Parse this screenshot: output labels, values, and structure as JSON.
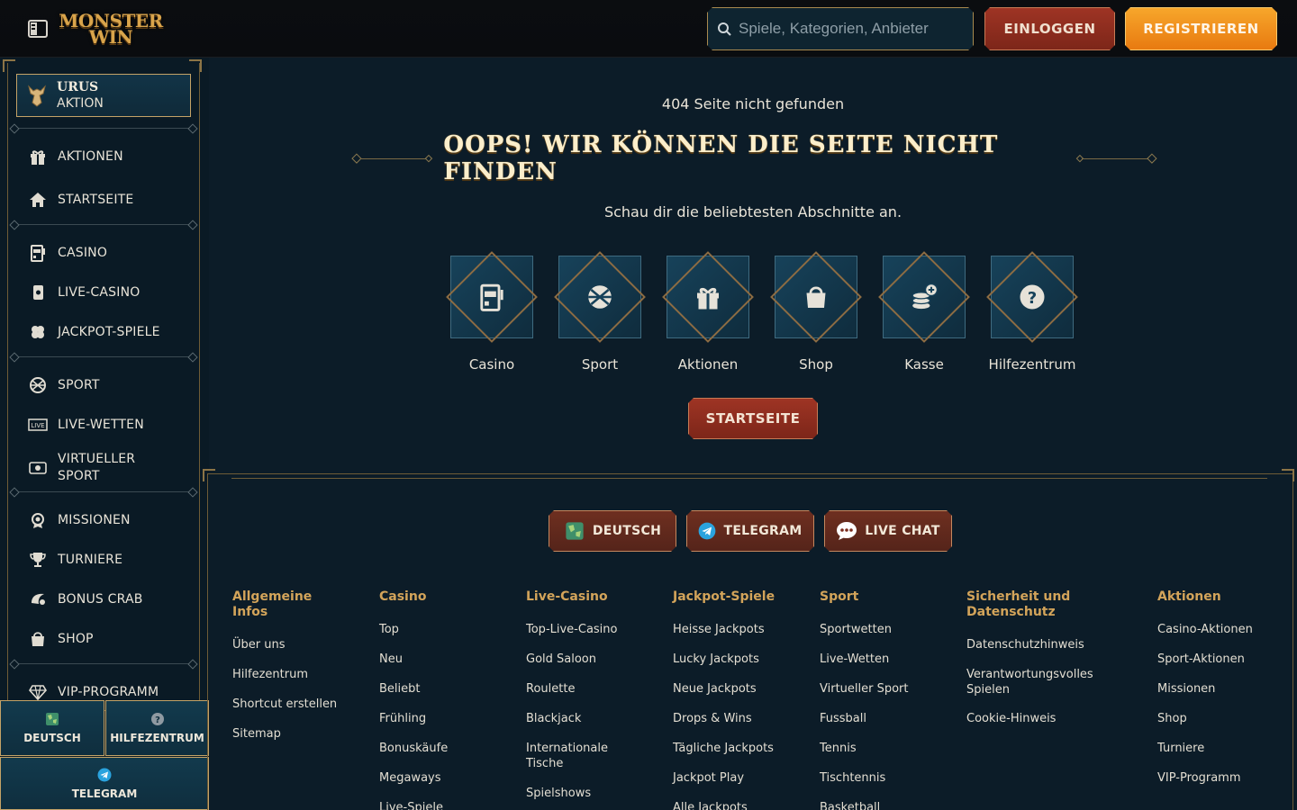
{
  "header": {
    "logo_line1": "MONSTER",
    "logo_line2": "WIN",
    "search_placeholder": "Spiele, Kategorien, Anbieter",
    "login_label": "EINLOGGEN",
    "register_label": "REGISTRIEREN"
  },
  "sidebar": {
    "promo": {
      "title": "URUS",
      "subtitle": "AKTION"
    },
    "items": [
      {
        "label": "AKTIONEN",
        "icon": "gift-icon"
      },
      {
        "label": "STARTSEITE",
        "icon": "home-icon"
      },
      {
        "label": "CASINO",
        "icon": "slot-machine-icon"
      },
      {
        "label": "LIVE-CASINO",
        "icon": "live-card-icon"
      },
      {
        "label": "JACKPOT-SPIELE",
        "icon": "clover-icon"
      },
      {
        "label": "SPORT",
        "icon": "ball-icon"
      },
      {
        "label": "LIVE-WETTEN",
        "icon": "live-badge-icon"
      },
      {
        "label": "VIRTUELLER SPORT",
        "icon": "virtual-sport-icon"
      },
      {
        "label": "MISSIONEN",
        "icon": "mission-icon"
      },
      {
        "label": "TURNIERE",
        "icon": "trophy-icon"
      },
      {
        "label": "BONUS CRAB",
        "icon": "crab-icon"
      },
      {
        "label": "SHOP",
        "icon": "bag-icon"
      },
      {
        "label": "VIP-PROGRAMM",
        "icon": "diamond-icon"
      }
    ],
    "bottom": {
      "language": "DEUTSCH",
      "help": "HILFEZENTRUM",
      "telegram": "TELEGRAM"
    }
  },
  "main": {
    "error_small": "404 Seite nicht gefunden",
    "headline": "OOPS! WIR KÖNNEN DIE SEITE NICHT FINDEN",
    "subtitle": "Schau dir die beliebtesten Abschnitte an.",
    "tiles": [
      {
        "label": "Casino",
        "icon": "slot-machine-icon"
      },
      {
        "label": "Sport",
        "icon": "ball-icon"
      },
      {
        "label": "Aktionen",
        "icon": "gift-icon"
      },
      {
        "label": "Shop",
        "icon": "bag-icon"
      },
      {
        "label": "Kasse",
        "icon": "coins-icon"
      },
      {
        "label": "Hilfezentrum",
        "icon": "question-icon"
      }
    ],
    "home_button": "STARTSEITE"
  },
  "footer": {
    "pills": [
      {
        "label": "DEUTSCH",
        "icon": "globe-icon"
      },
      {
        "label": "TELEGRAM",
        "icon": "telegram-icon"
      },
      {
        "label": "LIVE CHAT",
        "icon": "chat-icon"
      }
    ],
    "columns": [
      {
        "heading": "Allgemeine Infos",
        "links": [
          "Über uns",
          "Hilfezentrum",
          "Shortcut erstellen",
          "Sitemap"
        ]
      },
      {
        "heading": "Casino",
        "links": [
          "Top",
          "Neu",
          "Beliebt",
          "Frühling",
          "Bonuskäufe",
          "Megaways",
          "Live-Spiele"
        ]
      },
      {
        "heading": "Live-Casino",
        "links": [
          "Top-Live-Casino",
          "Gold Saloon",
          "Roulette",
          "Blackjack",
          "Internationale Tische",
          "Spielshows"
        ]
      },
      {
        "heading": "Jackpot-Spiele",
        "links": [
          "Heisse Jackpots",
          "Lucky Jackpots",
          "Neue Jackpots",
          "Drops & Wins",
          "Tägliche Jackpots",
          "Jackpot Play",
          "Alle Jackpots"
        ]
      },
      {
        "heading": "Sport",
        "links": [
          "Sportwetten",
          "Live-Wetten",
          "Virtueller Sport",
          "Fussball",
          "Tennis",
          "Tischtennis",
          "Basketball"
        ]
      },
      {
        "heading": "Sicherheit und Datenschutz",
        "links": [
          "Datenschutzhinweis",
          "Verantwortungsvolles Spielen",
          "Cookie-Hinweis"
        ]
      },
      {
        "heading": "Aktionen",
        "links": [
          "Casino-Aktionen",
          "Sport-Aktionen",
          "Missionen",
          "Shop",
          "Turniere",
          "VIP-Programm"
        ]
      }
    ]
  },
  "colors": {
    "background": "#0c1c28",
    "gold": "#d3a45a",
    "login_red": "#9e3424",
    "register_orange": "#f39420"
  }
}
